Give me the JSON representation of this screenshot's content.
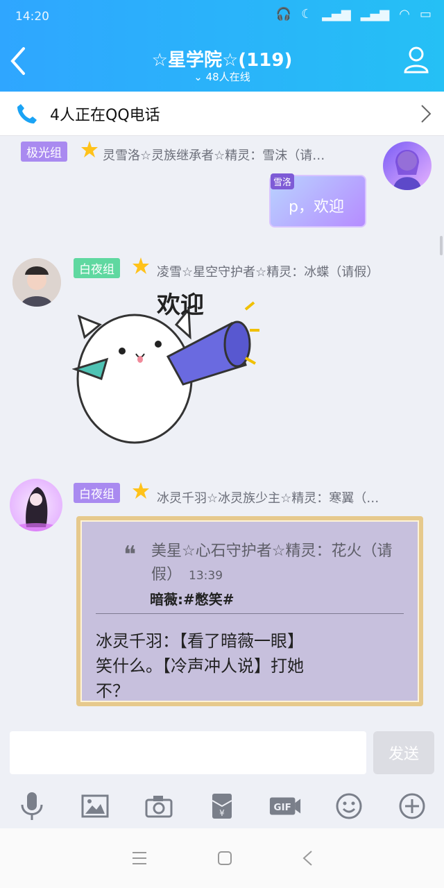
{
  "status_bar": {
    "time": "14:20"
  },
  "header": {
    "title": "☆星学院☆(119)",
    "online": "48人在线"
  },
  "callbar": {
    "text": "4人正在QQ电话"
  },
  "messages": [
    {
      "badge": "极光组",
      "badge_color": "#a98af0",
      "nick": "灵雪洛☆灵族继承者☆精灵：雪沫（请…",
      "bubble_tag": "雪洛",
      "bubble_text": "p，欢迎"
    },
    {
      "badge": "白夜组",
      "badge_color": "#5fd8a0",
      "nick": "凌雪☆星空守护者☆精灵：冰蝶（请假）",
      "sticker_text": "欢迎"
    },
    {
      "badge": "白夜组",
      "badge_color": "#a98af0",
      "nick": "冰灵千羽☆冰灵族少主☆精灵：寒翼（…",
      "quote_author": "美星☆心石守护者☆精灵：花火（请假）",
      "quote_time": "13:39",
      "quote_text": "暗薇:#憋笑#",
      "reply": "冰灵千羽：【看了暗薇一眼】笑什么。【冷声冲人说】打她不？"
    }
  ],
  "input": {
    "placeholder": "",
    "send_label": "发送"
  },
  "toolbar": [
    "microphone-icon",
    "image-icon",
    "camera-icon",
    "red-packet-icon",
    "gif-icon",
    "emoji-icon",
    "plus-icon"
  ],
  "colors": {
    "header": "#2fa6ff",
    "accent": "#25c0f5"
  }
}
